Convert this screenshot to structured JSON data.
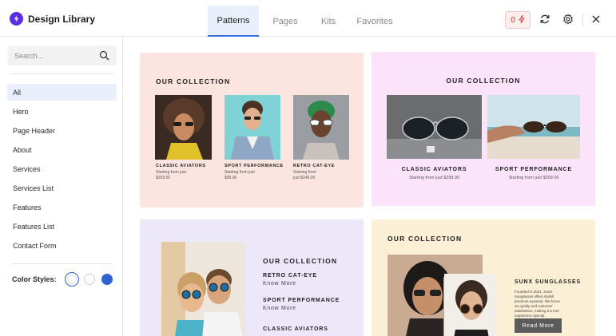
{
  "app": {
    "title": "Design Library"
  },
  "tabs": [
    {
      "label": "Patterns",
      "active": true
    },
    {
      "label": "Pages"
    },
    {
      "label": "Kits"
    },
    {
      "label": "Favorites"
    }
  ],
  "header": {
    "badge_count": "0",
    "badge_icon": "bolt-icon",
    "refresh_icon": "refresh-icon",
    "settings_icon": "gear-icon",
    "close_icon": "close-icon"
  },
  "sidebar": {
    "search_placeholder": "Search...",
    "categories": [
      {
        "label": "All",
        "active": true
      },
      {
        "label": "Hero"
      },
      {
        "label": "Page Header"
      },
      {
        "label": "About"
      },
      {
        "label": "Services"
      },
      {
        "label": "Services List"
      },
      {
        "label": "Features"
      },
      {
        "label": "Features List"
      },
      {
        "label": "Contact Form"
      }
    ],
    "color_styles_label": "Color Styles:",
    "color_swatches": [
      "#ffffff",
      "#ffffff",
      "#2f63d4"
    ],
    "selected_swatch": 0
  },
  "patterns": {
    "card1": {
      "heading": "OUR COLLECTION",
      "products": [
        {
          "name": "CLASSIC AVIATORS",
          "price_line1": "Starting from just",
          "price_line2": "$299.00"
        },
        {
          "name": "SPORT PERFORMANCE",
          "price_line1": "Starting from just",
          "price_line2": "$99.00"
        },
        {
          "name": "RETRO CAT-EYE",
          "price_line1": "Starting from",
          "price_line2": "just $149.00"
        }
      ]
    },
    "card2": {
      "heading": "OUR COLLECTION",
      "products": [
        {
          "name": "CLASSIC AVIATORS",
          "price": "Starting from just $299.00"
        },
        {
          "name": "SPORT PERFORMANCE",
          "price": "Starting from just $399.00"
        }
      ]
    },
    "card3": {
      "heading": "OUR COLLECTION",
      "items": [
        {
          "title": "RETRO CAT-EYE",
          "link": "Know More"
        },
        {
          "title": "SPORT PERFORMANCE",
          "link": "Know More"
        },
        {
          "title": "CLASSIC AVIATORS",
          "link": ""
        }
      ]
    },
    "card4": {
      "heading": "OUR COLLECTION",
      "product_title": "SUNX SUNGLASSES",
      "description": "Founded in 2021, SunX Sunglasses offers stylish premium eyewear. We focus on quality and customer satisfaction, making it a true experience special.",
      "button_label": "Read More"
    }
  }
}
